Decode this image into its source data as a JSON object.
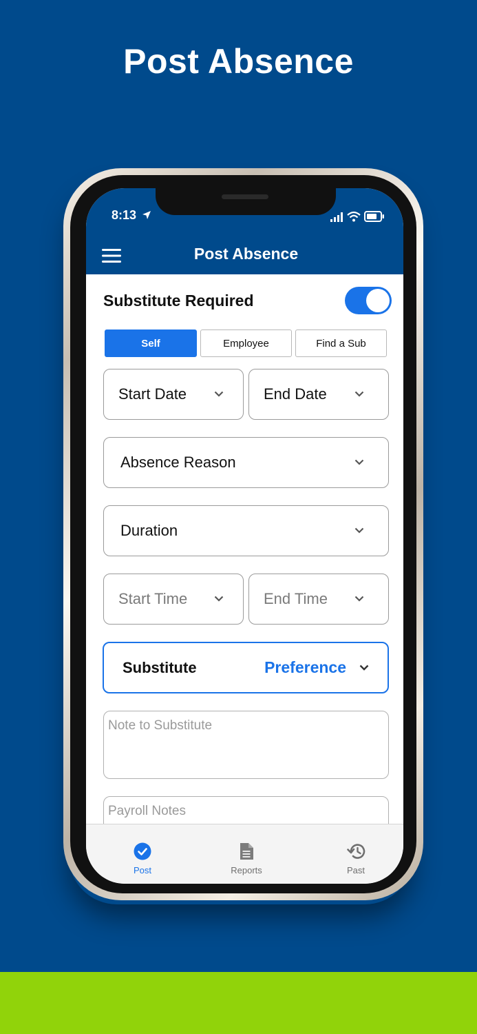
{
  "hero": {
    "title": "Post Absence"
  },
  "status_bar": {
    "time": "8:13"
  },
  "header": {
    "title": "Post Absence"
  },
  "substitute_required": {
    "label": "Substitute Required",
    "enabled": true
  },
  "segments": [
    {
      "label": "Self",
      "active": true
    },
    {
      "label": "Employee",
      "active": false
    },
    {
      "label": "Find a Sub",
      "active": false
    }
  ],
  "fields": {
    "start_date": "Start Date",
    "end_date": "End Date",
    "absence_reason": "Absence Reason",
    "duration": "Duration",
    "start_time": "Start Time",
    "end_time": "End Time",
    "substitute": "Substitute",
    "preference": "Preference"
  },
  "textareas": {
    "note_placeholder": "Note to Substitute",
    "payroll_placeholder": "Payroll Notes"
  },
  "tabs": [
    {
      "label": "Post",
      "icon": "check-circle-icon",
      "active": true
    },
    {
      "label": "Reports",
      "icon": "document-icon",
      "active": false
    },
    {
      "label": "Past",
      "icon": "history-icon",
      "active": false
    }
  ],
  "colors": {
    "brand_blue": "#004a8c",
    "accent_blue": "#1a73e8",
    "lime_green": "#91d30a"
  }
}
